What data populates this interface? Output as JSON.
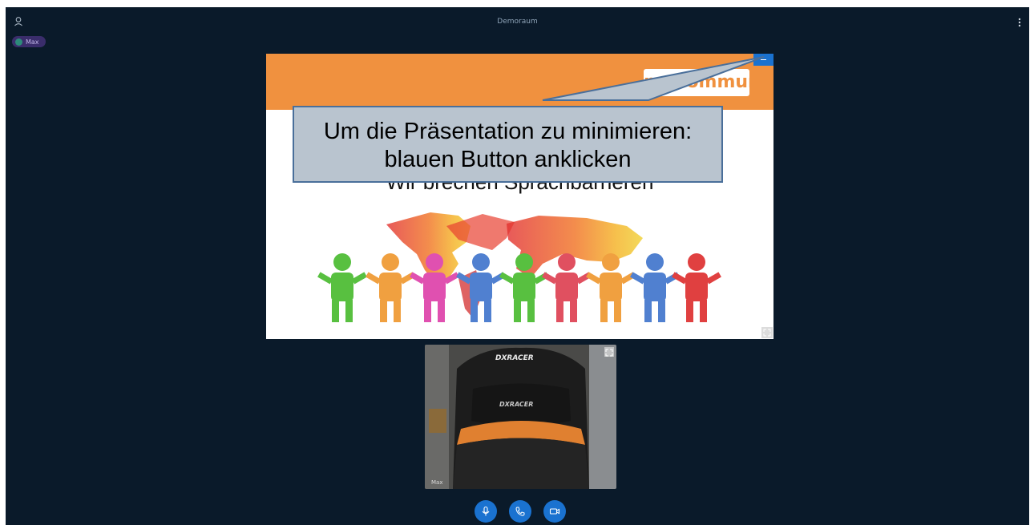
{
  "header": {
    "room_title": "Demoraum",
    "user_icon": "user-icon",
    "menu_icon": "vertical-dots-icon"
  },
  "participants": [
    {
      "name": "Max",
      "status_color": "#2d8a7a"
    }
  ],
  "presentation": {
    "logo_text": "myCommunicator",
    "heading": "Wir brechen Sprachbarrieren",
    "minimize_icon": "minimize-icon",
    "expand_icon": "expand-icon",
    "illustration": "world-map-with-people-holding-hands"
  },
  "callout": {
    "line1": "Um die Präsentation zu minimieren:",
    "line2": "blauen Button anklicken"
  },
  "video": {
    "participant_name": "Max",
    "brand_text_top": "DXRACER",
    "brand_text_bottom": "DXRACER",
    "expand_icon": "expand-icon"
  },
  "controls": [
    {
      "name": "microphone",
      "icon": "microphone-icon"
    },
    {
      "name": "phone",
      "icon": "phone-icon"
    },
    {
      "name": "camera",
      "icon": "camera-icon"
    }
  ],
  "colors": {
    "background": "#0a1a2a",
    "accent_blue": "#1a72d0",
    "slide_orange": "#f0913f",
    "callout_fill": "#b9c4cf",
    "callout_border": "#4a6f9a",
    "participant_tag": "#3a2d6b"
  }
}
